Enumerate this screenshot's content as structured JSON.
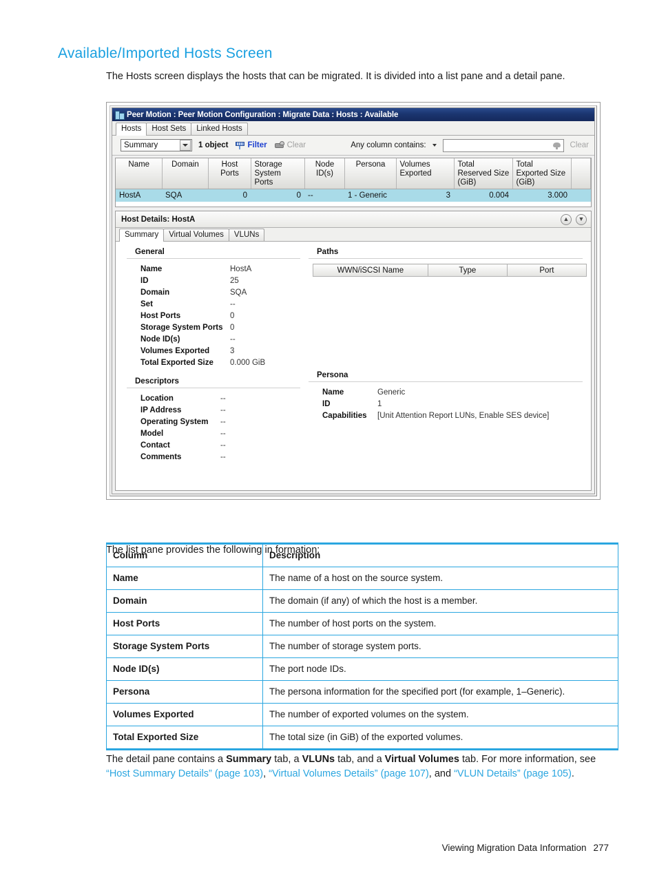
{
  "doc": {
    "title": "Available/Imported Hosts Screen",
    "intro": "The Hosts screen displays the hosts that can be migrated. It is divided into a list pane and a detail pane.",
    "list_pane_intro": "The list pane provides the following in formation:",
    "detail_paragraph": {
      "part1": "The detail pane contains a ",
      "tab1": "Summary",
      "part2": " tab, a ",
      "tab2": "VLUNs",
      "part3": " tab, and a ",
      "tab3": "Virtual Volumes",
      "part4": " tab. For more information, see ",
      "link1": "“Host Summary Details” (page 103)",
      "sep1": ", ",
      "link2": "“Virtual Volumes Details” (page 107)",
      "sep2": ", and ",
      "link3": "“VLUN Details” (page 105)",
      "end": "."
    },
    "footer": {
      "section": "Viewing Migration Data Information",
      "page_number": "277"
    },
    "accent_color": "#2aa6e0"
  },
  "app": {
    "titlebar": {
      "text": "Peer Motion : Peer Motion Configuration : Migrate Data : Hosts : Available",
      "bg_color": "#1b3570"
    },
    "tabs": [
      {
        "label": "Hosts",
        "active": true
      },
      {
        "label": "Host Sets",
        "active": false
      },
      {
        "label": "Linked Hosts",
        "active": false
      }
    ],
    "toolbar": {
      "view_select_value": "Summary",
      "object_count": "1 object",
      "filter_label": "Filter",
      "clear_label": "Clear",
      "search_label": "Any column contains:",
      "search_value": "",
      "search_clear_label": "Clear"
    },
    "list_pane": {
      "columns": [
        "Name",
        "Domain",
        "Host Ports",
        "Storage System Ports",
        "Node ID(s)",
        "Persona",
        "Volumes Exported",
        "Total Reserved Size (GiB)",
        "Total Exported Size (GiB)"
      ],
      "columns_display": [
        "Name",
        "Domain",
        "Host Ports",
        "Storage<br>System Ports",
        "Node ID(s)",
        "Persona",
        "Volumes<br>Exported",
        "Total<br>Reserved Size<br>(GiB)",
        "Total<br>Exported Size<br>(GiB)"
      ],
      "rows": [
        {
          "name": "HostA",
          "domain": "SQA",
          "host_ports": "0",
          "storage_system_ports": "0",
          "node_ids": "--",
          "persona": "1 - Generic",
          "volumes_exported": "3",
          "total_reserved_size": "0.004",
          "total_exported_size": "3.000",
          "selected": true
        }
      ],
      "selected_row_color": "#a9dbe8"
    },
    "details": {
      "header_title": "Host Details: HostA",
      "tabs": [
        {
          "label": "Summary",
          "active": true
        },
        {
          "label": "Virtual Volumes",
          "active": false
        },
        {
          "label": "VLUNs",
          "active": false
        }
      ],
      "general": {
        "title": "General",
        "fields": [
          {
            "label": "Name",
            "value": "HostA"
          },
          {
            "label": "ID",
            "value": "25"
          },
          {
            "label": "Domain",
            "value": "SQA"
          },
          {
            "label": "Set",
            "value": "--"
          },
          {
            "label": "Host Ports",
            "value": "0"
          },
          {
            "label": "Storage System Ports",
            "value": "0"
          },
          {
            "label": "Node ID(s)",
            "value": "--"
          },
          {
            "label": "Volumes Exported",
            "value": "3"
          },
          {
            "label": "Total Exported Size",
            "value": "0.000 GiB"
          }
        ]
      },
      "descriptors": {
        "title": "Descriptors",
        "fields": [
          {
            "label": "Location",
            "value": "--"
          },
          {
            "label": "IP Address",
            "value": "--"
          },
          {
            "label": "Operating System",
            "value": "--"
          },
          {
            "label": "Model",
            "value": "--"
          },
          {
            "label": "Contact",
            "value": "--"
          },
          {
            "label": "Comments",
            "value": "--"
          }
        ]
      },
      "paths": {
        "title": "Paths",
        "columns": [
          "WWN/iSCSI Name",
          "Type",
          "Port"
        ],
        "rows": []
      },
      "persona": {
        "title": "Persona",
        "fields": [
          {
            "label": "Name",
            "value": "Generic"
          },
          {
            "label": "ID",
            "value": "1"
          },
          {
            "label": "Capabilities",
            "value": "[Unit Attention Report LUNs, Enable SES device]"
          }
        ]
      }
    }
  },
  "column_table": {
    "headers": [
      "Column",
      "Description"
    ],
    "rows": [
      {
        "column": "Name",
        "description": "The name of a host on the source system."
      },
      {
        "column": "Domain",
        "description": "The domain (if any) of which the host is a member."
      },
      {
        "column": "Host Ports",
        "description": "The number of host ports on the system."
      },
      {
        "column": "Storage System Ports",
        "description": "The number of storage system ports."
      },
      {
        "column": "Node ID(s)",
        "description": "The port node IDs."
      },
      {
        "column": "Persona",
        "description": "The persona information for the specified port (for example, 1–Generic)."
      },
      {
        "column": "Volumes Exported",
        "description": "The number of exported volumes on the system."
      },
      {
        "column": "Total Exported Size",
        "description": "The total size (in GiB) of the exported volumes."
      }
    ]
  }
}
